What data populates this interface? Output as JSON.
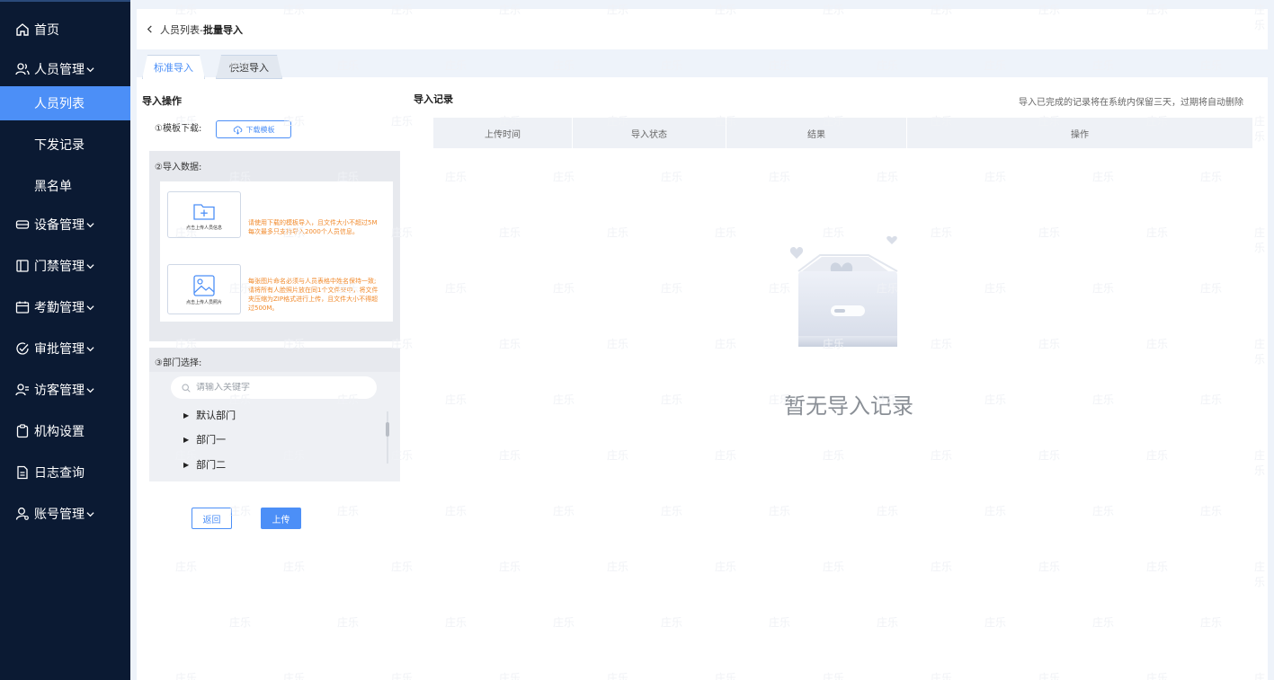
{
  "sidebar": {
    "items": [
      {
        "label": "首页",
        "icon": "home-icon"
      },
      {
        "label": "人员管理",
        "icon": "users-icon",
        "expandable": true
      },
      {
        "label": "人员列表",
        "active": true
      },
      {
        "label": "下发记录"
      },
      {
        "label": "黑名单"
      },
      {
        "label": "设备管理",
        "icon": "device-icon",
        "expandable": true
      },
      {
        "label": "门禁管理",
        "icon": "door-icon",
        "expandable": true
      },
      {
        "label": "考勤管理",
        "icon": "calendar-icon",
        "expandable": true
      },
      {
        "label": "审批管理",
        "icon": "check-circle-icon",
        "expandable": true
      },
      {
        "label": "访客管理",
        "icon": "visitor-icon",
        "expandable": true
      },
      {
        "label": "机构设置",
        "icon": "clipboard-icon"
      },
      {
        "label": "日志查询",
        "icon": "document-icon"
      },
      {
        "label": "账号管理",
        "icon": "account-icon",
        "expandable": true
      }
    ]
  },
  "breadcrumb": {
    "parent": "人员列表-",
    "current": "批量导入"
  },
  "tabs": [
    {
      "label": "标准导入",
      "active": true
    },
    {
      "label": "快速导入",
      "active": false
    }
  ],
  "import_panel": {
    "title": "导入操作",
    "template_label": "①模板下载:",
    "download_button": "下载模板",
    "data_label": "②导入数据:",
    "upload_person": {
      "label": "点击上传人员信息",
      "hint_line1": "请使用下载的模板导入，且文件大小不超过5M",
      "hint_line2": "每次最多只支持导入2000个人员信息。"
    },
    "upload_photo": {
      "label": "点击上传人员照片",
      "hint_line1": "每张图片命名必须与人员表格中姓名保持一致;",
      "hint_line2": "请将所有人脸照片放在同1个文件夹中，将文件",
      "hint_line3": "夹压缩为ZIP格式进行上传，且文件大小不得超",
      "hint_line4": "过500M。"
    },
    "dept_label": "③部门选择:",
    "search_placeholder": "请输入关键字",
    "departments": [
      "默认部门",
      "部门一",
      "部门二"
    ],
    "return_button": "返回",
    "upload_button": "上传"
  },
  "records": {
    "title": "导入记录",
    "notice": "导入已完成的记录将在系统内保留三天，过期将自动删除",
    "columns": [
      "上传时间",
      "导入状态",
      "结果",
      "操作"
    ],
    "empty_text": "暂无导入记录"
  },
  "watermark": "庄乐",
  "colors": {
    "accent": "#4c8ff7",
    "sidebar_bg": "#0b1a33",
    "hint_orange": "#f18a2c"
  }
}
